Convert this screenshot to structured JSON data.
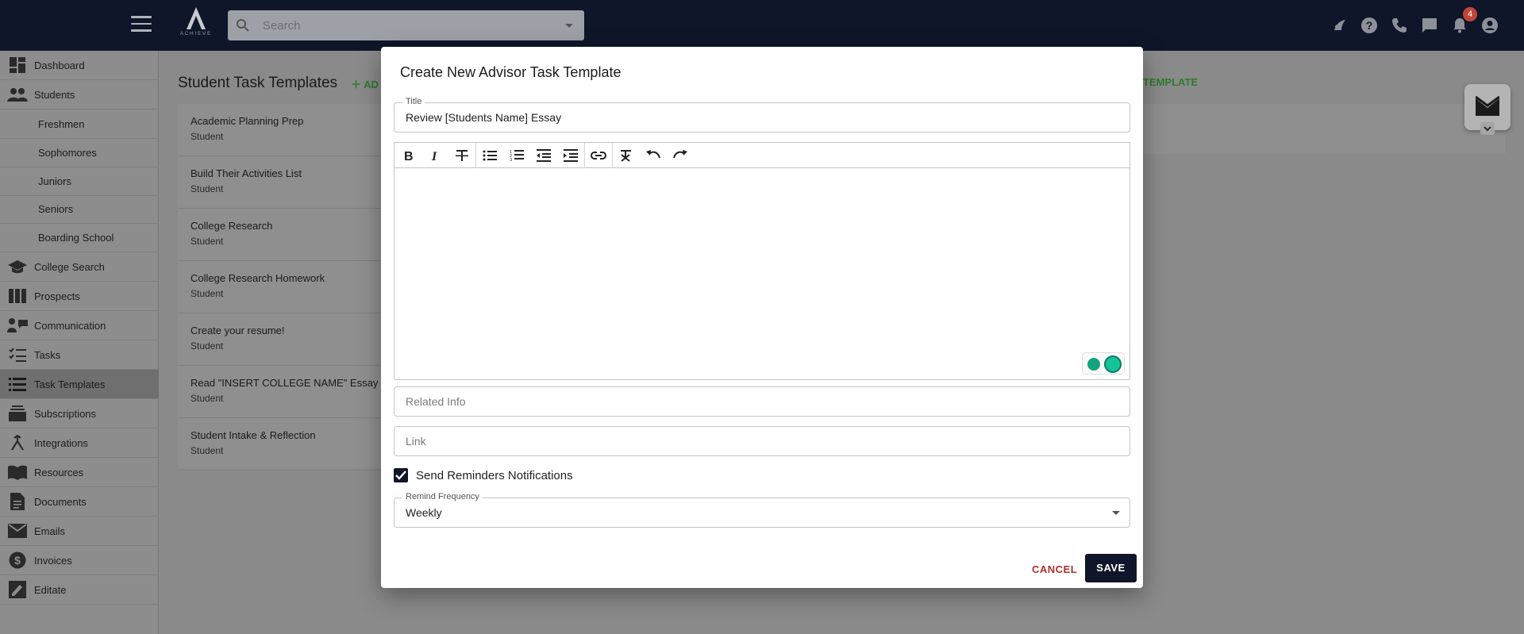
{
  "topbar": {
    "search_placeholder": "Search",
    "notification_count": "4",
    "logo_text": "ACHIEVE"
  },
  "sidebar": {
    "items": [
      {
        "label": "Dashboard",
        "icon": "dashboard-icon"
      },
      {
        "label": "Students",
        "icon": "students-icon"
      },
      {
        "label": "Freshmen"
      },
      {
        "label": "Sophomores"
      },
      {
        "label": "Juniors"
      },
      {
        "label": "Seniors"
      },
      {
        "label": "Boarding School"
      },
      {
        "label": "College Search",
        "icon": "graduation-cap-icon"
      },
      {
        "label": "Prospects",
        "icon": "columns-icon"
      },
      {
        "label": "Communication",
        "icon": "communication-icon"
      },
      {
        "label": "Tasks",
        "icon": "checklist-icon"
      },
      {
        "label": "Task Templates",
        "icon": "list-icon"
      },
      {
        "label": "Subscriptions",
        "icon": "subscriptions-icon"
      },
      {
        "label": "Integrations",
        "icon": "merge-icon"
      },
      {
        "label": "Resources",
        "icon": "book-icon"
      },
      {
        "label": "Documents",
        "icon": "document-icon"
      },
      {
        "label": "Emails",
        "icon": "mail-icon"
      },
      {
        "label": "Invoices",
        "icon": "dollar-icon"
      },
      {
        "label": "Editate",
        "icon": "edit-icon"
      }
    ]
  },
  "main": {
    "title": "Student Task Templates",
    "add_label": "AD",
    "add_label_right": "TEMPLATE",
    "templates": [
      {
        "name": "Academic Planning Prep",
        "type": "Student"
      },
      {
        "name": "Build Their Activities List",
        "type": "Student"
      },
      {
        "name": "College Research",
        "type": "Student"
      },
      {
        "name": "College Research Homework",
        "type": "Student"
      },
      {
        "name": "Create your resume!",
        "type": "Student"
      },
      {
        "name": "Read \"INSERT COLLEGE NAME\" Essay Pro",
        "type": "Student"
      },
      {
        "name": "Student Intake & Reflection",
        "type": "Student"
      }
    ]
  },
  "modal": {
    "title": "Create New Advisor Task Template",
    "title_field": {
      "label": "Title",
      "value": "Review [Students Name] Essay"
    },
    "related_info_placeholder": "Related Info",
    "link_placeholder": "Link",
    "reminders_label": "Send Reminders Notifications",
    "reminders_checked": true,
    "frequency": {
      "label": "Remind Frequency",
      "value": "Weekly"
    },
    "cancel_label": "CANCEL",
    "save_label": "SAVE"
  },
  "colors": {
    "topbar": "#0f1629",
    "accent_green": "#2d7a2d",
    "cancel_red": "#b03030",
    "save_bg": "#0f1629"
  }
}
